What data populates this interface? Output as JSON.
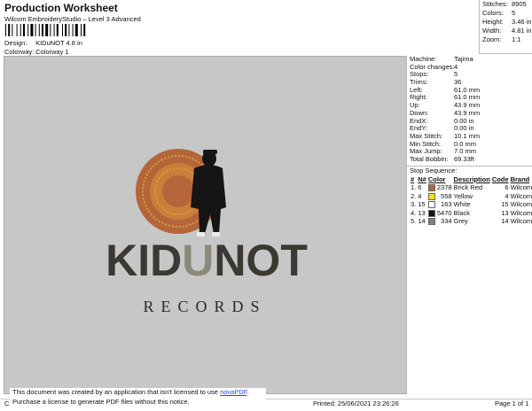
{
  "header": {
    "title": "Production Worksheet",
    "subtitle": "Wilcom EmbroideryStudio – Level 3 Advanced",
    "design_label": "Design:",
    "design_value": "KIDuNOT 4.8 in",
    "colorway_label": "Colorway:",
    "colorway_value": "Colorway 1"
  },
  "summary": [
    {
      "label": "Stitches:",
      "value": "8905"
    },
    {
      "label": "Colors:",
      "value": "5"
    },
    {
      "label": "Height:",
      "value": "3.46 in"
    },
    {
      "label": "Width:",
      "value": "4.81 in"
    },
    {
      "label": "Zoom:",
      "value": "1:1"
    }
  ],
  "machine_info": [
    {
      "label": "Machine:",
      "value": "Tajima"
    },
    {
      "label": "Color changes:",
      "value": "4"
    },
    {
      "label": "Stops:",
      "value": "5"
    },
    {
      "label": "Trims:",
      "value": "36"
    },
    {
      "label": "Left:",
      "value": "61.0 mm"
    },
    {
      "label": "Right:",
      "value": "61.0 mm"
    },
    {
      "label": "Up:",
      "value": "43.9 mm"
    },
    {
      "label": "Down:",
      "value": "43.9 mm"
    },
    {
      "label": "EndX:",
      "value": "0.00 in"
    },
    {
      "label": "EndY:",
      "value": "0.00 in"
    },
    {
      "label": "Max Stitch:",
      "value": "10.1 mm"
    },
    {
      "label": "Min Stitch:",
      "value": "0.0 mm"
    },
    {
      "label": "Max Jump:",
      "value": "7.0 mm"
    },
    {
      "label": "Total Bobbin:",
      "value": "69.33ft"
    }
  ],
  "stop_sequence": {
    "title": "Stop Sequence:",
    "headers": [
      "#",
      "N#",
      "Color",
      "Description",
      "Code",
      "Brand"
    ],
    "rows": [
      {
        "num": "1.",
        "n": "6",
        "swatch": "#b5653a",
        "color": "2378",
        "description": "Brick Red",
        "code": "6",
        "brand": "Wilcom"
      },
      {
        "num": "2.",
        "n": "4",
        "swatch": "#f2e21b",
        "color": "558",
        "description": "Yellow",
        "code": "4",
        "brand": "Wilcom"
      },
      {
        "num": "3.",
        "n": "15",
        "swatch": "#ffffff",
        "color": "163",
        "description": "White",
        "code": "15",
        "brand": "Wilcom"
      },
      {
        "num": "4.",
        "n": "13",
        "swatch": "#111111",
        "color": "5470",
        "description": "Black",
        "code": "13",
        "brand": "Wilcom"
      },
      {
        "num": "5.",
        "n": "14",
        "swatch": "#808080",
        "color": "334",
        "description": "Grey",
        "code": "14",
        "brand": "Wilcom"
      }
    ]
  },
  "artwork": {
    "logo_text_left": "KID",
    "logo_text_u": "U",
    "logo_text_right": "NOT",
    "records_text": "RECORDS"
  },
  "notice": {
    "line1_prefix": "This document was created by an application that isn't licensed to use ",
    "link": "novaPDF",
    "line1_suffix": ".",
    "line2": "Purchase a license to generate PDF files without this notice."
  },
  "footer": {
    "left": "Cr",
    "printed": "Printed: 25/06/2021 23:26:26",
    "page": "Page 1 of 1"
  },
  "colors": {
    "canvas": "#c7c7c7",
    "logo_dark": "#3a3a32",
    "circle_outer": "#b5653a",
    "circle_inner": "#d2a33c"
  }
}
